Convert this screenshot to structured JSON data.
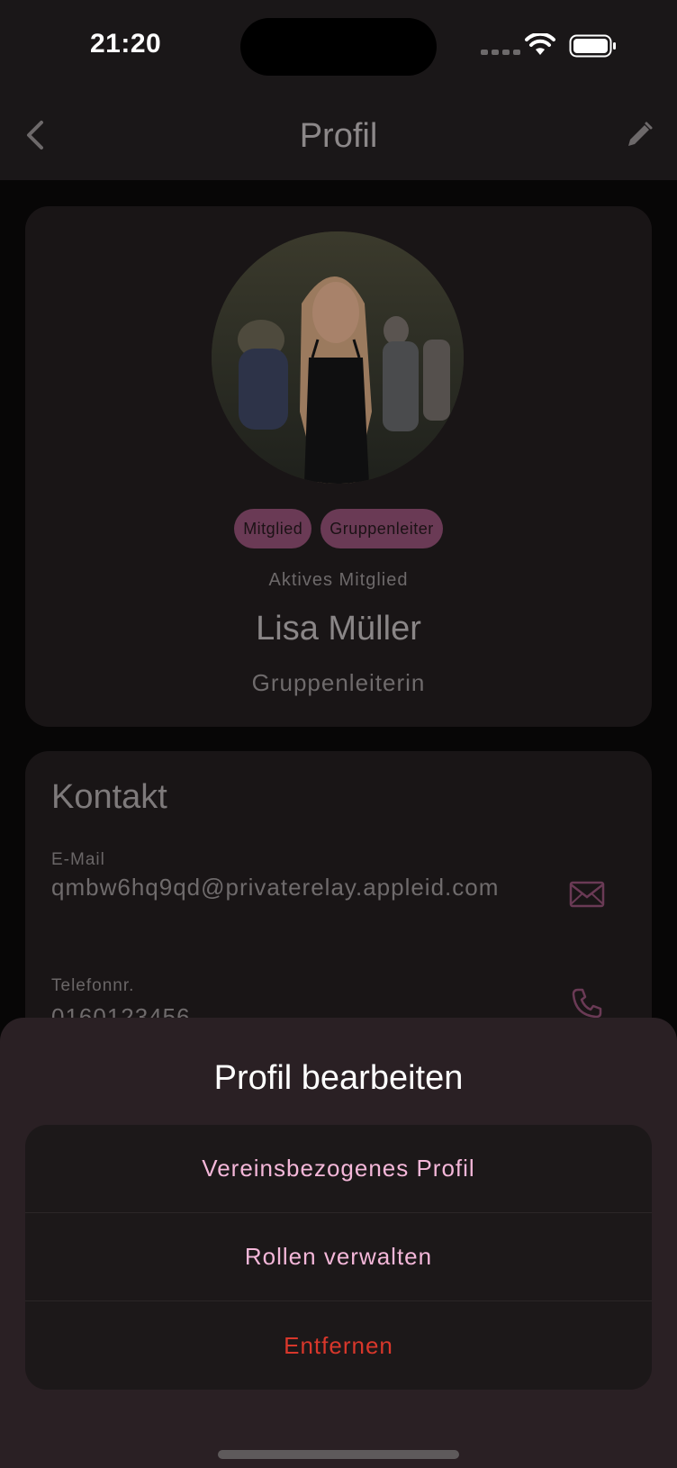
{
  "status_bar": {
    "time": "21:20"
  },
  "nav": {
    "title": "Profil",
    "back_icon": "chevron-left-icon",
    "edit_icon": "pencil-icon"
  },
  "profile": {
    "badges": [
      "Mitglied",
      "Gruppenleiter"
    ],
    "status": "Aktives Mitglied",
    "name": "Lisa Müller",
    "role": "Gruppenleiterin"
  },
  "contact": {
    "heading": "Kontakt",
    "email_label": "E-Mail",
    "email_value": "qmbw6hq9qd@privaterelay.appleid.com",
    "phone_label": "Telefonnr.",
    "phone_value": "0160123456"
  },
  "sheet": {
    "title": "Profil bearbeiten",
    "items": [
      {
        "label": "Vereinsbezogenes Profil"
      },
      {
        "label": "Rollen verwalten"
      },
      {
        "label": "Entfernen"
      }
    ]
  },
  "colors": {
    "accent": "#f4b7d9",
    "danger": "#d8372b",
    "badge": "#6a3a55",
    "sheet_bg": "#2a2024"
  }
}
